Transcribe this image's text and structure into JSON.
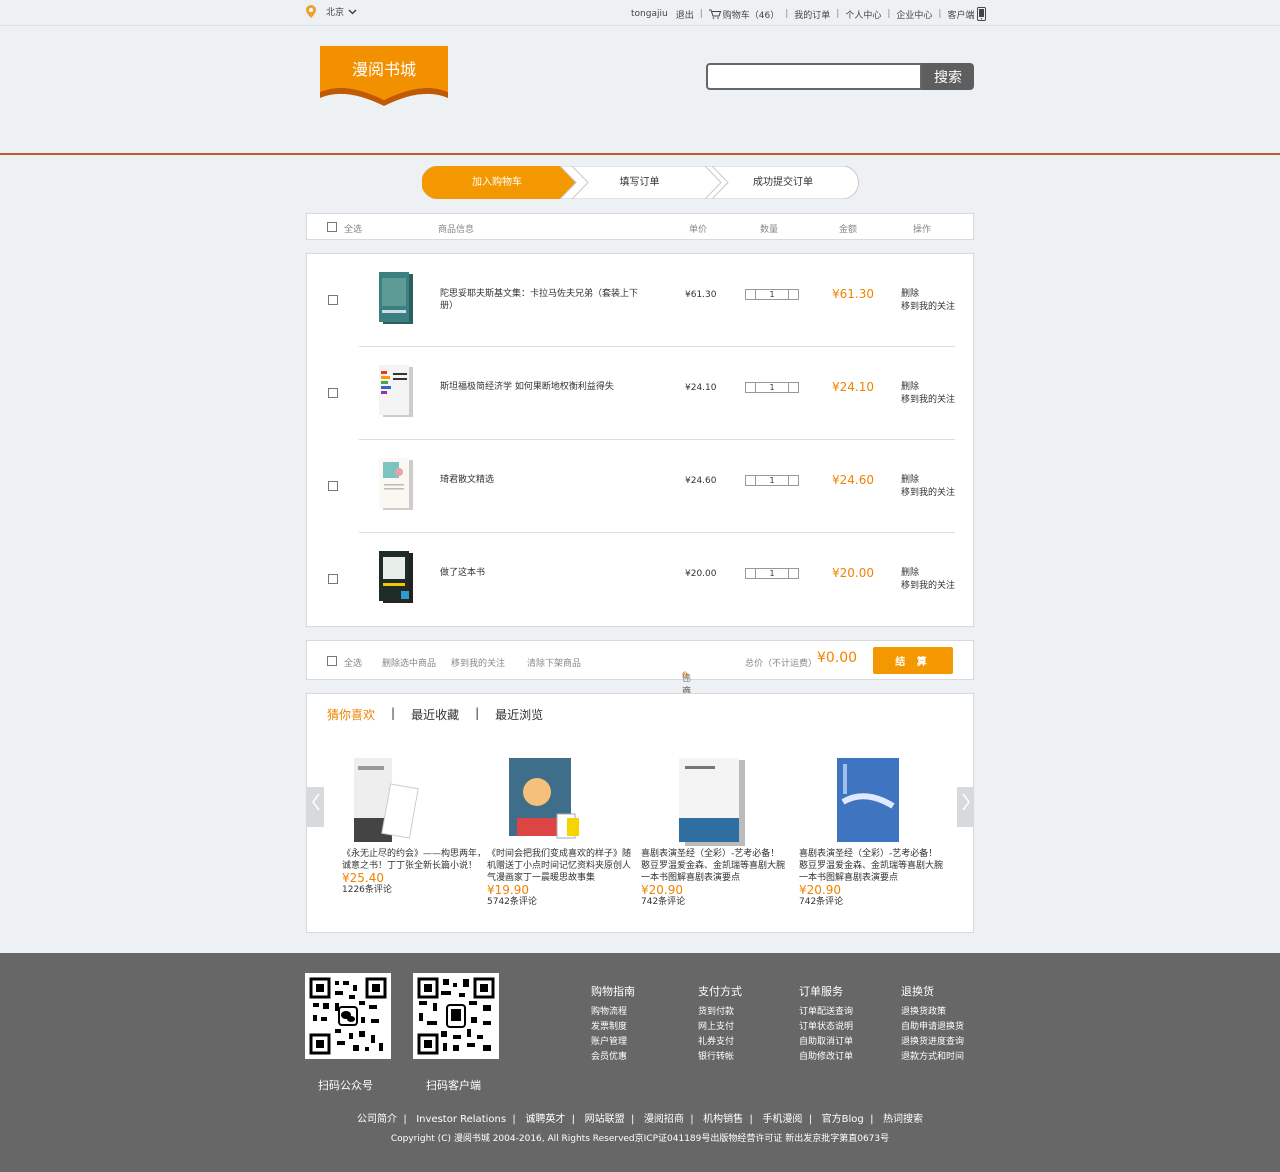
{
  "topbar": {
    "location": "北京",
    "links": [
      "tongajiu",
      "退出",
      "购物车（46）",
      "我的订单",
      "个人中心",
      "企业中心",
      "客户端"
    ]
  },
  "header": {
    "logo_text": "漫阅书城",
    "search_placeholder": "",
    "search_button": "搜索"
  },
  "steps": [
    "加入购物车",
    "填写订单",
    "成功提交订单"
  ],
  "cart_header": {
    "select_all": "全选",
    "product_info": "商品信息",
    "unit_price": "单价",
    "quantity": "数量",
    "amount": "金额",
    "operation": "操作"
  },
  "cart_items": [
    {
      "title": "陀思妥耶夫斯基文集：卡拉马佐夫兄弟（套装上下册）",
      "price": "¥61.30",
      "qty": "1",
      "amount": "¥61.30",
      "delete": "删除",
      "follow": "移到我的关注"
    },
    {
      "title": "斯坦福极简经济学 如何果断地权衡利益得失",
      "price": "¥24.10",
      "qty": "1",
      "amount": "¥24.10",
      "delete": "删除",
      "follow": "移到我的关注"
    },
    {
      "title": "琦君散文精选",
      "price": "¥24.60",
      "qty": "1",
      "amount": "¥24.60",
      "delete": "删除",
      "follow": "移到我的关注"
    },
    {
      "title": "做了这本书",
      "price": "¥20.00",
      "qty": "1",
      "amount": "¥20.00",
      "delete": "删除",
      "follow": "移到我的关注"
    }
  ],
  "cart_footer": {
    "select_all": "全选",
    "delete_selected": "删除选中商品",
    "move_follow": "移到我的关注",
    "clear_offshelf": "清除下架商品",
    "selected_prefix": "已选",
    "selected_count": "0",
    "selected_suffix": "件商品",
    "total_label": "总价（不计运费）",
    "total": "¥0.00",
    "checkout": "结 算"
  },
  "recommend": {
    "tabs": [
      "猜你喜欢",
      "最近收藏",
      "最近浏览"
    ],
    "items": [
      {
        "title": "《永无止尽的约会》——构思两年，诚意之书！丁丁张全新长篇小说！",
        "price": "¥25.40",
        "comments": "1226条评论"
      },
      {
        "title": "《时间会把我们变成喜欢的样子》随机赠送丁小点时间记忆资料夹原创人气漫画家丁一晨暖思故事集",
        "price": "¥19.90",
        "comments": "5742条评论"
      },
      {
        "title": "喜剧表演圣经（全彩）-艺考必备！憨豆罗温爱金森、金凯瑞等喜剧大腕一本书图解喜剧表演要点",
        "price": "¥20.90",
        "comments": "742条评论"
      },
      {
        "title": "喜剧表演圣经（全彩）-艺考必备！憨豆罗温爱金森、金凯瑞等喜剧大腕一本书图解喜剧表演要点",
        "price": "¥20.90",
        "comments": "742条评论"
      }
    ]
  },
  "footer": {
    "qr_labels": [
      "扫码公众号",
      "扫码客户端"
    ],
    "columns": [
      {
        "title": "购物指南",
        "items": [
          "购物流程",
          "发票制度",
          "账户管理",
          "会员优惠"
        ]
      },
      {
        "title": "支付方式",
        "items": [
          "货到付款",
          "网上支付",
          "礼券支付",
          "银行转帐"
        ]
      },
      {
        "title": "订单服务",
        "items": [
          "订单配送查询",
          "订单状态说明",
          "自助取消订单",
          "自助修改订单"
        ]
      },
      {
        "title": "退换货",
        "items": [
          "退换货政策",
          "自助申请退换货",
          "退换货进度查询",
          "退款方式和时间"
        ]
      }
    ],
    "links": [
      "公司简介",
      "Investor Relations",
      "诚聘英才",
      "网站联盟",
      "漫阅招商",
      "机构销售",
      "手机漫阅",
      "官方Blog",
      "热词搜索"
    ],
    "copyright": "Copyright (C) 漫阅书城 2004-2016, All Rights Reserved京ICP证041189号出版物经营许可证 新出发京批字第直0673号"
  },
  "colors": {
    "accent": "#f39800",
    "footer_bg": "#676767",
    "divider": "#b65d2b"
  }
}
